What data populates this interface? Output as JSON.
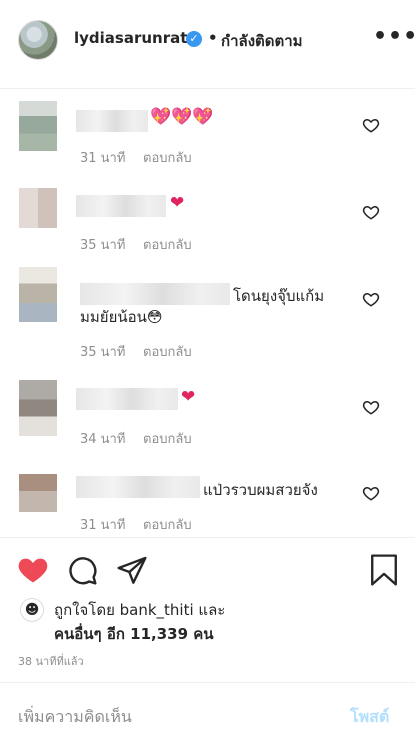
{
  "header": {
    "username": "lydiasarunrat",
    "verified_icon": "verified-badge-icon",
    "separator": "•",
    "following_label": "กำลังติดตาม",
    "more_label": "•••"
  },
  "comments": [
    {
      "text": "",
      "emoji": "💖💖💖",
      "time": "31 นาที",
      "reply": "ตอบกลับ"
    },
    {
      "text": "",
      "emoji": "❤",
      "time": "35 นาที",
      "reply": "ตอบกลับ"
    },
    {
      "text": "โดนยุงจุ๊บแก้ม",
      "text2": "มมยัยน้อน😳",
      "time": "35 นาที",
      "reply": "ตอบกลับ"
    },
    {
      "text": "",
      "emoji": "❤",
      "time": "34 นาที",
      "reply": "ตอบกลับ"
    },
    {
      "text": "แป่วรวบผมสวยจัง",
      "time": "31 นาที",
      "reply": "ตอบกลับ"
    }
  ],
  "likes": {
    "line1": "ถูกใจโดย bank_thiti และ",
    "line2": "คนอื่นๆ อีก 11,339 คน"
  },
  "time_ago": "38 นาทีที่แล้ว",
  "comment_input": {
    "placeholder": "เพิ่มความคิดเห็น"
  },
  "post_button": "โพสต์",
  "colors": {
    "like_red": "#ed4956",
    "link_blue": "#3897f0",
    "post_disabled": "#b2dffc"
  }
}
